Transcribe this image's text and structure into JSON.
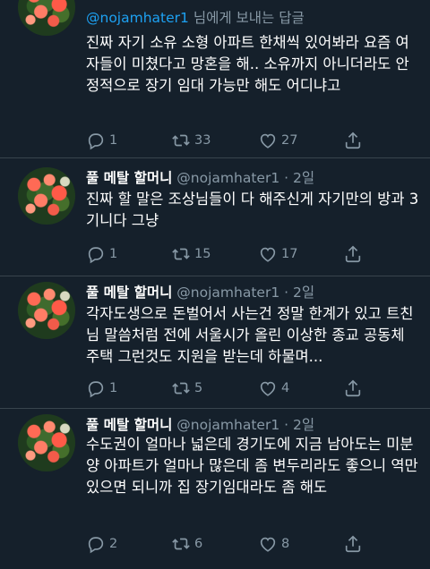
{
  "first_tweet": {
    "reply_to_handle": "@nojamhater1",
    "reply_suffix": " 님에게 보내는 답글",
    "text": "진짜 자기 소유 소형 아파트 한채씩 있어봐라 요즘 여자들이 미쳤다고 망혼을 해.. 소유까지 아니더라도 안정적으로 장기 임대 가능만 해도 어디냐고",
    "replies": "1",
    "retweets": "33",
    "likes": "27"
  },
  "tweets": [
    {
      "name": "풀 메탈 할머니",
      "handle": "@nojamhater1",
      "time": "· 2일",
      "text": "진짜 할 말은 조상님들이 다 해주신게 자기만의 방과 3기니다 그냥",
      "replies": "1",
      "retweets": "15",
      "likes": "17"
    },
    {
      "name": "풀 메탈 할머니",
      "handle": "@nojamhater1",
      "time": "· 2일",
      "text": "각자도생으로 돈벌어서 사는건 정말 한계가 있고 트친님 말씀처럼 전에 서울시가 올린 이상한 종교 공동체 주택 그런것도 지원을 받는데 하물며...",
      "replies": "1",
      "retweets": "5",
      "likes": "4"
    },
    {
      "name": "풀 메탈 할머니",
      "handle": "@nojamhater1",
      "time": "· 2일",
      "text": "수도권이 얼마나 넓은데 경기도에 지금 남아도는 미분양 아파트가 얼마나 많은데 좀 변두리라도 좋으니 역만 있으면 되니까 집 장기임대라도 좀 해도",
      "replies": "2",
      "retweets": "6",
      "likes": "8"
    }
  ],
  "icons": [
    "reply-icon",
    "retweet-icon",
    "like-icon",
    "share-icon"
  ],
  "colors": {
    "background": "#15202b",
    "secondary_text": "#8899a6",
    "mention": "#1da1f2",
    "divider": "#38444d"
  }
}
